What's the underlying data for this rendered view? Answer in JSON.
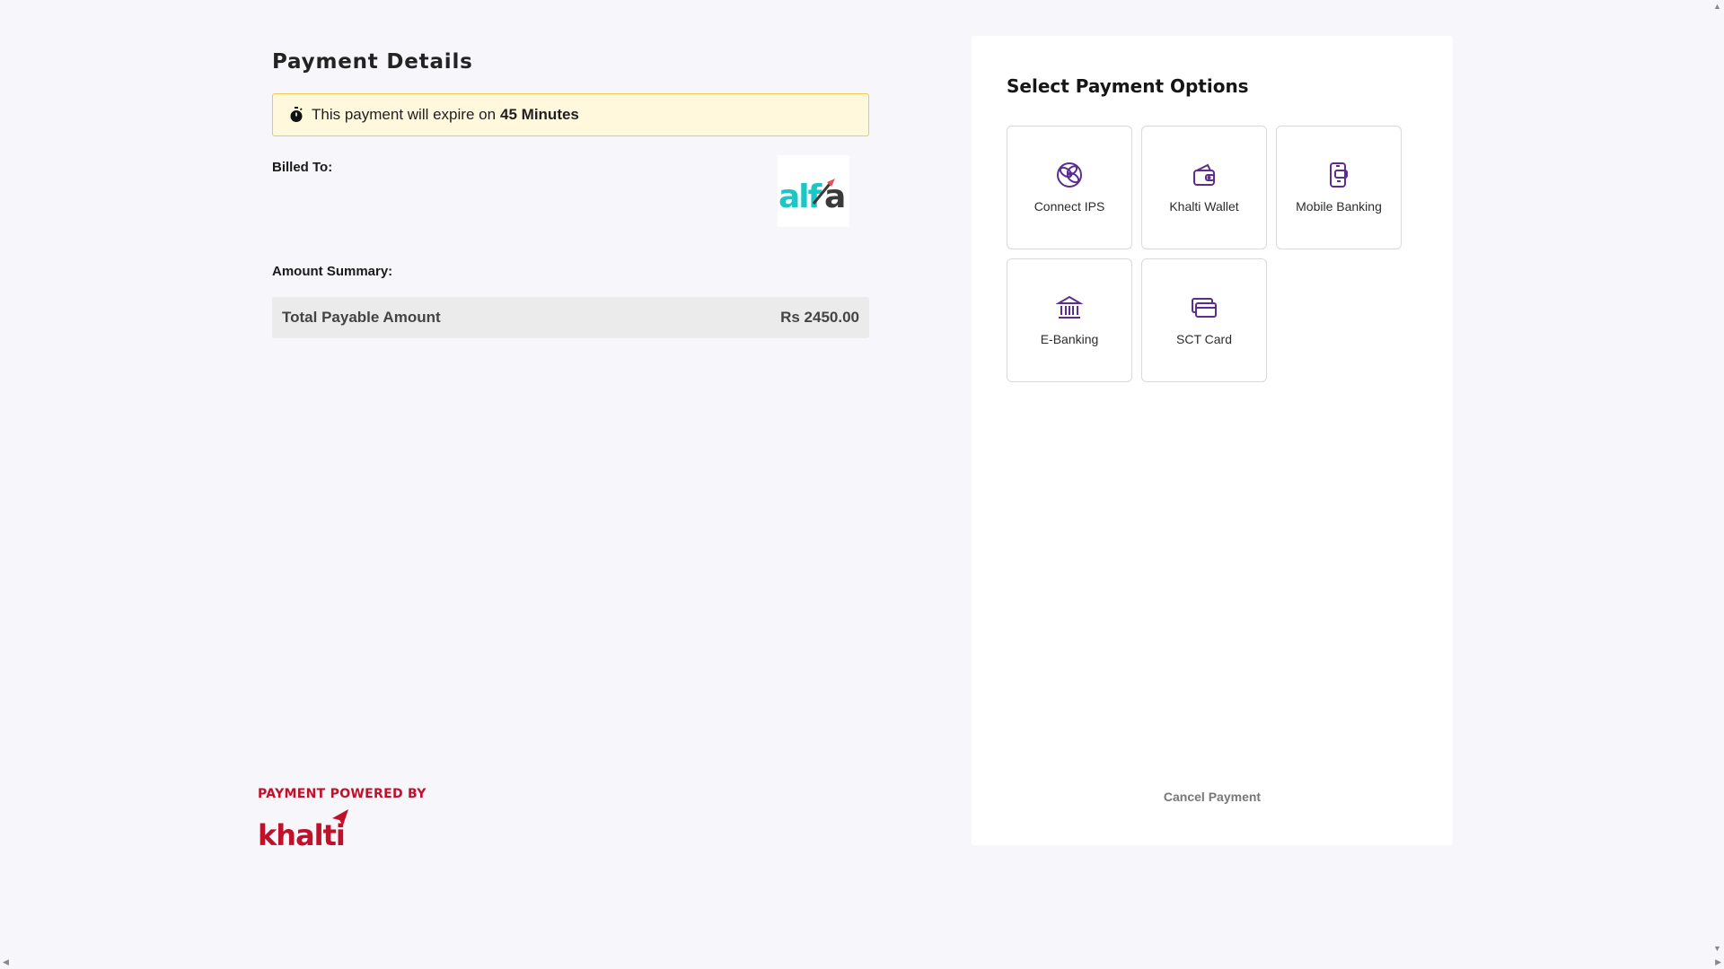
{
  "payment_details": {
    "title": "Payment Details",
    "expiry_text": "This payment will expire on",
    "expiry_value": "45 Minutes",
    "billed_to_label": "Billed To:",
    "merchant_logo_text": "alfa",
    "amount_summary_label": "Amount Summary:",
    "total_label": "Total Payable Amount",
    "total_value": "Rs 2450.00"
  },
  "footer": {
    "powered_by": "PAYMENT POWERED BY",
    "brand_text": "khalti"
  },
  "payment_options": {
    "title": "Select Payment Options",
    "options": [
      {
        "label": "Connect IPS",
        "icon": "connect-ips-icon"
      },
      {
        "label": "Khalti Wallet",
        "icon": "wallet-icon"
      },
      {
        "label": "Mobile Banking",
        "icon": "mobile-banking-icon"
      },
      {
        "label": "E-Banking",
        "icon": "bank-icon"
      },
      {
        "label": "SCT Card",
        "icon": "card-icon"
      }
    ],
    "cancel_label": "Cancel Payment"
  },
  "colors": {
    "background": "#f7f6fa",
    "accent_purple": "#5c2d91",
    "khalti_red": "#c0102a",
    "expiry_bg": "#fff8dc",
    "expiry_border": "#f2c94c",
    "alfa_teal": "#1cc6c6"
  }
}
